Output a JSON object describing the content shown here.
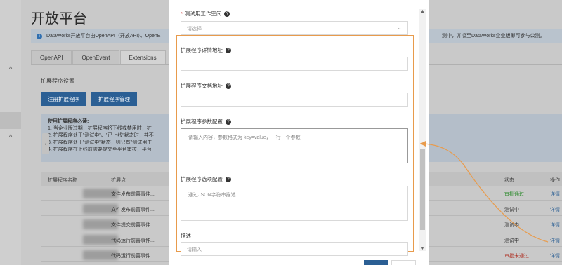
{
  "page": {
    "title": "开放平台",
    "notice_text": "DataWorks开放平台由OpenAPI（开放API）、OpenE",
    "notice_right": "测中，并吸至DataWorks企业版即可参与公测。",
    "tabs": [
      {
        "label": "OpenAPI"
      },
      {
        "label": "OpenEvent"
      },
      {
        "label": "Extensions"
      }
    ],
    "section_title": "扩展程序设置",
    "btn_register": "注册扩展程序",
    "btn_manage": "扩展程序管理",
    "alert": {
      "title": "使用扩展程序必读:",
      "lines": [
        "1. 当企业版过期，扩展程序将下线或禁用时，扩",
        "2. 扩展程序处于\"测试中\"、\"已上线\"状态时，并不",
        "3. 扩展程序处于\"测试中\"状态，则只有\"测试用工",
        "4. 扩展程序在上线前需要提交至平台审核，平台"
      ]
    },
    "table": {
      "headers": {
        "name": "扩展程序名称",
        "point": "扩展点",
        "status": "状态",
        "op": "操作"
      },
      "rows": [
        {
          "point": "文件发布前置事件...",
          "status": "审批通过",
          "op": "详情"
        },
        {
          "point": "文件发布前置事件...",
          "status": "测试中",
          "op": "详情"
        },
        {
          "point": "文件提交前置事件...",
          "status": "测试中",
          "op": "详情"
        },
        {
          "point": "代码运行前置事件...",
          "status": "测试中",
          "op": "详情"
        },
        {
          "point": "代码运行前置事件...",
          "status": "审批未通过",
          "op": "详情"
        }
      ]
    }
  },
  "dialog": {
    "workspace_label": "测试用工作空间",
    "workspace_placeholder": "请选择",
    "detail_url_label": "扩展程序详情地址",
    "doc_url_label": "扩展程序文档地址",
    "params_label": "扩展程序参数配置",
    "params_placeholder": "请输入内容，参数格式为 key=value，一行一个参数",
    "options_label": "扩展程序选项配置",
    "options_placeholder": "通过JSON字符串描述",
    "desc_label": "描述",
    "desc_placeholder": "请输入"
  },
  "colors": {
    "highlight": "#e89b4c",
    "primary": "#2b5f94",
    "status_pass": "#2e8b2e",
    "status_fail": "#b03a2e"
  }
}
